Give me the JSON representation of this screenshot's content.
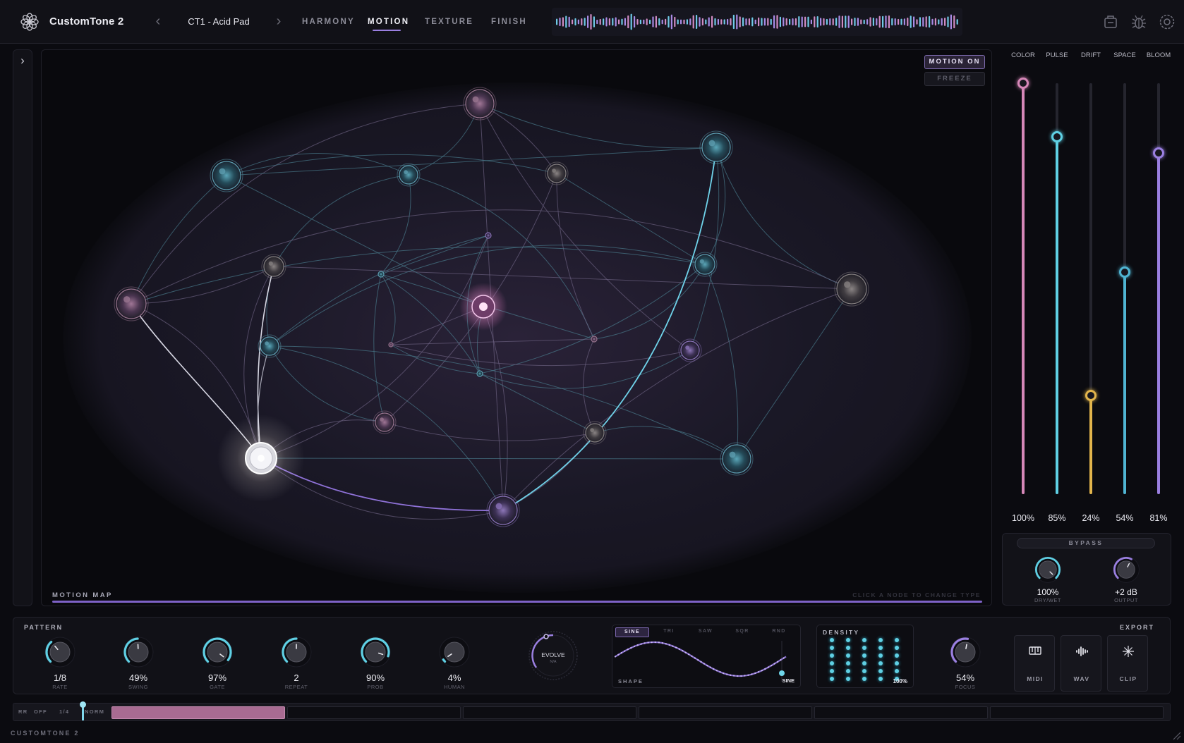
{
  "app": {
    "title": "CustomTone 2",
    "footer": "CUSTOMTONE 2"
  },
  "preset": {
    "name": "CT1 - Acid Pad",
    "prev_icon": "chevron-left-icon",
    "next_icon": "chevron-right-icon"
  },
  "tabs": [
    {
      "label": "HARMONY",
      "active": false
    },
    {
      "label": "MOTION",
      "active": true
    },
    {
      "label": "TEXTURE",
      "active": false
    },
    {
      "label": "FINISH",
      "active": false
    }
  ],
  "header_icons": [
    "save-icon",
    "bug-icon",
    "settings-icon"
  ],
  "map": {
    "label": "MOTION MAP",
    "hint": "CLICK A NODE TO CHANGE TYPE",
    "motion_button": "MOTION ON",
    "freeze_button": "FREEZE"
  },
  "sliders": [
    {
      "name": "COLOR",
      "value": "100%",
      "level": 1.0,
      "color": "#d687b8"
    },
    {
      "name": "PULSE",
      "value": "85%",
      "level": 0.87,
      "color": "#5fd0e4"
    },
    {
      "name": "DRIFT",
      "value": "24%",
      "level": 0.24,
      "color": "#e2b54c"
    },
    {
      "name": "SPACE",
      "value": "54%",
      "level": 0.54,
      "color": "#4fb4d2"
    },
    {
      "name": "BLOOM",
      "value": "81%",
      "level": 0.83,
      "color": "#9a7fe0"
    }
  ],
  "bypass": {
    "label": "BYPASS",
    "drywet": {
      "value": "100%",
      "label": "DRY/WET",
      "level": 1.0
    },
    "output": {
      "value": "+2 dB",
      "label": "OUTPUT",
      "level": 0.6
    }
  },
  "pattern": {
    "title": "PATTERN",
    "knobs": [
      {
        "id": "rate",
        "value": "1/8",
        "label": "RATE",
        "level": 0.35
      },
      {
        "id": "swing",
        "value": "49%",
        "label": "SWING",
        "level": 0.49
      },
      {
        "id": "gate",
        "value": "97%",
        "label": "GATE",
        "level": 0.97
      },
      {
        "id": "repeat",
        "value": "2",
        "label": "REPEAT",
        "level": 0.5
      },
      {
        "id": "prob",
        "value": "90%",
        "label": "PROB",
        "level": 0.9
      },
      {
        "id": "human",
        "value": "4%",
        "label": "HUMAN",
        "level": 0.04
      }
    ],
    "evolve": {
      "label": "EVOLVE",
      "sub": "N/A"
    },
    "shape": {
      "tabs": [
        "SINE",
        "TRI",
        "SAW",
        "SQR",
        "RND"
      ],
      "active": "SINE",
      "label": "SHAPE",
      "value": "SINE"
    },
    "density": {
      "title": "DENSITY",
      "value": "100%"
    },
    "focus": {
      "value": "54%",
      "label": "FOCUS",
      "level": 0.54
    },
    "export": {
      "title": "EXPORT",
      "buttons": [
        {
          "label": "MIDI",
          "icon": "piano-icon"
        },
        {
          "label": "WAV",
          "icon": "audio-wave-icon"
        },
        {
          "label": "CLIP",
          "icon": "sparkle-icon"
        }
      ]
    }
  },
  "timeline": {
    "chips": [
      "RR",
      "OFF",
      "1/4",
      "NORM"
    ],
    "segments": 6,
    "active_segment": 0
  }
}
